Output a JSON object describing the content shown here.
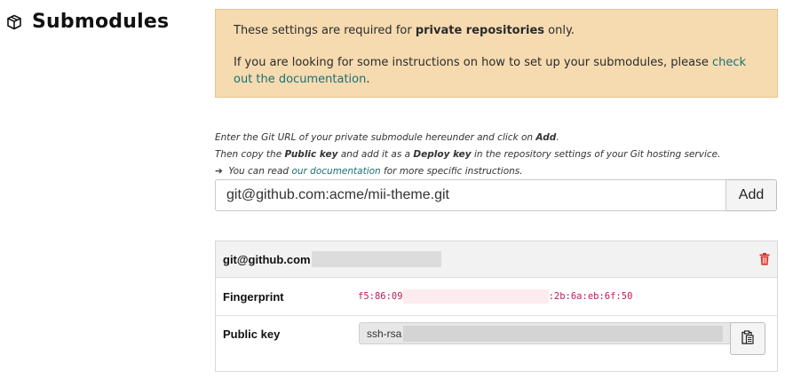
{
  "heading": {
    "icon": "package-icon",
    "title": "Submodules"
  },
  "alert": {
    "line1_prefix": "These settings are required for ",
    "line1_bold": "private repositories",
    "line1_suffix": " only.",
    "line2_prefix": "If you are looking for some instructions on how to set up your submodules, please ",
    "line2_link": "check out the documentation",
    "line2_suffix": ".",
    "background_color": "#f6dbb0",
    "link_color": "#1b6f73"
  },
  "help": {
    "line1_prefix": "Enter the Git URL of your private submodule hereunder and click on ",
    "line1_bold": "Add",
    "line1_suffix": ".",
    "line2_prefix": "Then copy the ",
    "line2_bold1": "Public key",
    "line2_mid": " and add it as a ",
    "line2_bold2": "Deploy key",
    "line2_suffix": " in the repository settings of your Git hosting service.",
    "line3_arrow": "➔",
    "line3_prefix": " You can read ",
    "line3_link": "our documentation",
    "line3_suffix": " for more specific instructions."
  },
  "url_form": {
    "value": "git@github.com:acme/mii-theme.git",
    "add_label": "Add"
  },
  "submodule": {
    "host": "git@github.com",
    "delete_icon": "trash-icon",
    "fingerprint_label": "Fingerprint",
    "fingerprint_start": "f5:86:09",
    "fingerprint_end": ":2b:6a:eb:6f:50",
    "public_key_label": "Public key",
    "public_key_prefix": "ssh-rsa",
    "copy_icon": "clipboard-icon",
    "fingerprint_color": "#c2185b",
    "delete_color": "#d9342b"
  }
}
